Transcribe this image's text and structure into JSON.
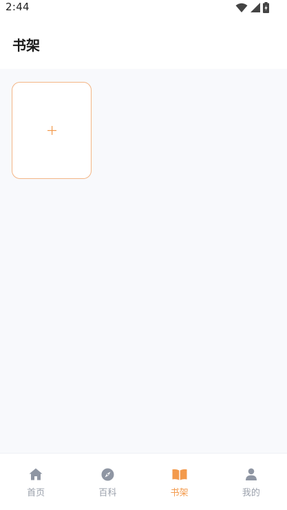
{
  "status_bar": {
    "time": "2:44",
    "icons": [
      "wifi-icon",
      "cell-signal-icon",
      "battery-icon"
    ]
  },
  "header": {
    "title": "书架"
  },
  "bookshelf": {
    "add_card": {
      "symbol": "+"
    }
  },
  "tabbar": {
    "items": [
      {
        "label": "首页",
        "icon": "home-icon",
        "active": false
      },
      {
        "label": "百科",
        "icon": "compass-icon",
        "active": false
      },
      {
        "label": "书架",
        "icon": "book-icon",
        "active": true
      },
      {
        "label": "我的",
        "icon": "user-icon",
        "active": false
      }
    ]
  },
  "colors": {
    "accent": "#f39a4c",
    "card_border": "#f3b585",
    "inactive": "#9aa0ab",
    "content_bg": "#f8f9fc"
  }
}
